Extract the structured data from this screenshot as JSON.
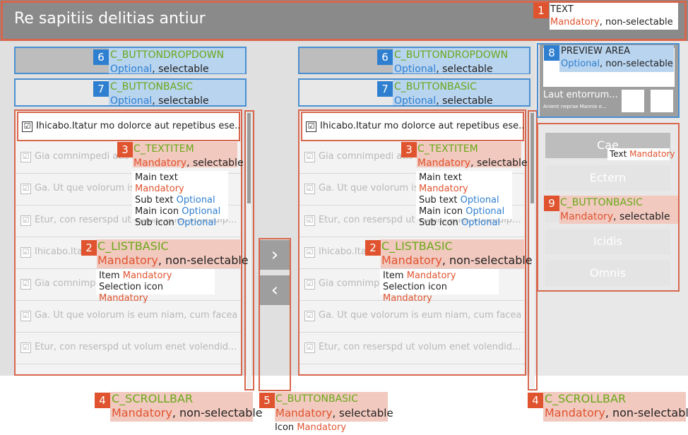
{
  "header": {
    "title": "Re sapitiis delitias antiur"
  },
  "list_items": [
    "Ihicabo.Itatur mo dolorce aut repetibus ese...",
    "Gia comnimpedi atis sam...",
    "Ga. Ut que volorum is...",
    "Etur, con reserspd ut volum enet volendip...",
    "Ihicabo.Itatur...",
    "Gia comnimp...",
    "Ga. Ut que volorum is eum niam, cum facea...",
    "Etur, con reserspd ut volum enet volendid..."
  ],
  "checkmark": "☑",
  "transfer": {
    "right_arrow": "›",
    "left_arrow": "‹"
  },
  "preview": {
    "title": "Laut entorrum...",
    "subtitle": "Anient neprae Mannis e..."
  },
  "side_buttons": [
    "Cae",
    "Ectern",
    "",
    "Icidis",
    "Omnis"
  ],
  "annotations": {
    "a1": {
      "num": "1",
      "name": "TEXT",
      "req": "Mandatory",
      "sel": ", non-selectable"
    },
    "a2": {
      "num": "2",
      "name": "C_LISTBASIC",
      "req": "Mandatory",
      "sel": ", non-selectable",
      "details": [
        {
          "label": "Item ",
          "req": "Mandatory"
        },
        {
          "label": "Selection icon ",
          "req": "Mandatory"
        }
      ]
    },
    "a3": {
      "num": "3",
      "name": "C_TEXTITEM",
      "req": "Mandatory",
      "sel": ", selectable",
      "details": [
        {
          "label": "Main text ",
          "req": "Mandatory"
        },
        {
          "label": "Sub text ",
          "req": "Optional"
        },
        {
          "label": "Main icon ",
          "req": "Optional"
        },
        {
          "label": "Sub icon ",
          "req": "Optional"
        }
      ]
    },
    "a4": {
      "num": "4",
      "name": "C_SCROLLBAR",
      "req": "Mandatory",
      "sel": ", non-selectable"
    },
    "a5": {
      "num": "5",
      "name": "C_BUTTONBASIC",
      "req": "Mandatory",
      "sel": ", selectable",
      "detail_label": "Icon ",
      "detail_req": "Mandatory"
    },
    "a6": {
      "num": "6",
      "name": "C_BUTTONDROPDOWN",
      "req": "Optional",
      "sel": ", selectable"
    },
    "a7": {
      "num": "7",
      "name": "C_BUTTONBASIC",
      "req": "Optional",
      "sel": ", selectable"
    },
    "a8": {
      "num": "8",
      "name": "PREVIEW AREA",
      "req": "Optional",
      "sel": ", non-selectable"
    },
    "a9": {
      "num": "9",
      "name": "C_BUTTONBASIC",
      "req": "Mandatory",
      "sel": ", selectable",
      "text_label": "Text ",
      "text_req": "Mandatory"
    }
  },
  "colors": {
    "accent_red": "#d7664d",
    "accent_blue": "#4a8fd1",
    "label_green": "#6aa81a"
  }
}
